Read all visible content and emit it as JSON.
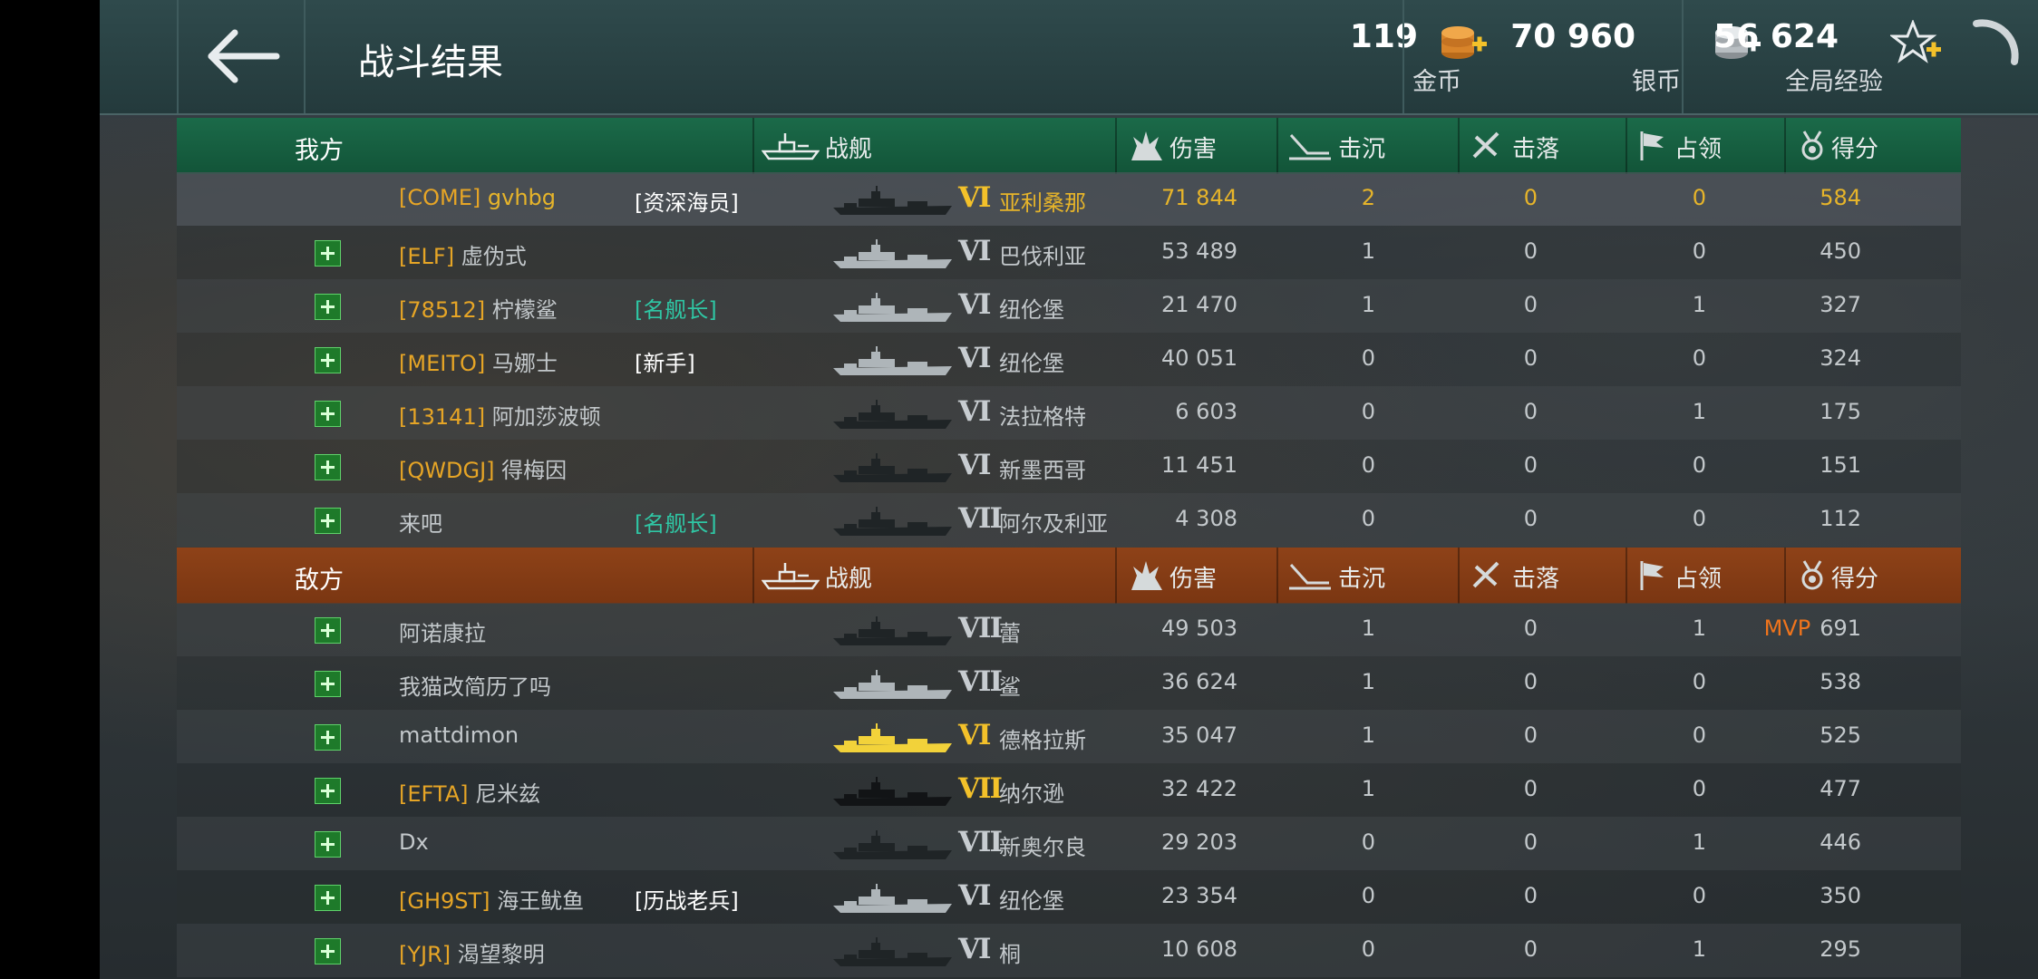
{
  "header": {
    "title": "战斗结果",
    "gold": {
      "value": "119",
      "label": "金币"
    },
    "silver": {
      "value": "70 960",
      "label": "银币"
    },
    "xp": {
      "value": "56 624",
      "label": "全局经验"
    }
  },
  "columns": {
    "ship": "战舰",
    "damage": "伤害",
    "kills": "击沉",
    "planes": "击落",
    "capture": "占领",
    "score": "得分"
  },
  "allies": {
    "label": "我方",
    "players": [
      {
        "clan": "[COME]",
        "name": "gvhbg",
        "title": "[资深海员]",
        "title_type": "vet",
        "tier": "VI",
        "ship": "亚利桑那",
        "damage": "71 844",
        "kills": "2",
        "planes": "0",
        "capture": "0",
        "score": "584",
        "is_me": true,
        "sil": "dark"
      },
      {
        "clan": "[ELF]",
        "name": "虚伪式",
        "title": "",
        "title_type": "",
        "tier": "VI",
        "ship": "巴伐利亚",
        "damage": "53 489",
        "kills": "1",
        "planes": "0",
        "capture": "0",
        "score": "450",
        "sil": "light"
      },
      {
        "clan": "[78512]",
        "name": "柠檬鲨",
        "title": "[名舰长]",
        "title_type": "cap",
        "tier": "VI",
        "ship": "纽伦堡",
        "damage": "21 470",
        "kills": "1",
        "planes": "0",
        "capture": "1",
        "score": "327",
        "sil": "light"
      },
      {
        "clan": "[MEITO]",
        "name": "马娜士",
        "title": "[新手]",
        "title_type": "vet",
        "tier": "VI",
        "ship": "纽伦堡",
        "damage": "40 051",
        "kills": "0",
        "planes": "0",
        "capture": "0",
        "score": "324",
        "sil": "light"
      },
      {
        "clan": "[13141]",
        "name": "阿加莎波顿",
        "title": "",
        "title_type": "",
        "tier": "VI",
        "ship": "法拉格特",
        "damage": "6 603",
        "kills": "0",
        "planes": "0",
        "capture": "1",
        "score": "175",
        "sil": "dark"
      },
      {
        "clan": "[QWDGJ]",
        "name": "得梅因",
        "title": "",
        "title_type": "",
        "tier": "VI",
        "ship": "新墨西哥",
        "damage": "11 451",
        "kills": "0",
        "planes": "0",
        "capture": "0",
        "score": "151",
        "sil": "dark"
      },
      {
        "clan": "",
        "name": "来吧",
        "title": "[名舰长]",
        "title_type": "cap",
        "tier": "VII",
        "ship": "阿尔及利亚",
        "damage": "4 308",
        "kills": "0",
        "planes": "0",
        "capture": "0",
        "score": "112",
        "sil": "dark"
      }
    ]
  },
  "enemies": {
    "label": "敌方",
    "players": [
      {
        "clan": "",
        "name": "阿诺康拉",
        "title": "",
        "title_type": "",
        "tier": "VII",
        "ship": "蕾",
        "damage": "49 503",
        "kills": "1",
        "planes": "0",
        "capture": "1",
        "score": "691",
        "mvp": "MVP",
        "sil": "dark"
      },
      {
        "clan": "",
        "name": "我猫改简历了吗",
        "title": "",
        "title_type": "",
        "tier": "VII",
        "ship": "鲨",
        "damage": "36 624",
        "kills": "1",
        "planes": "0",
        "capture": "0",
        "score": "538",
        "sil": "light"
      },
      {
        "clan": "",
        "name": "mattdimon",
        "title": "",
        "title_type": "",
        "tier": "VI",
        "ship": "德格拉斯",
        "damage": "35 047",
        "kills": "1",
        "planes": "0",
        "capture": "0",
        "score": "525",
        "sil": "gold",
        "tier_gold": true
      },
      {
        "clan": "[EFTA]",
        "name": "尼米兹",
        "title": "",
        "title_type": "",
        "tier": "VII",
        "ship": "纳尔逊",
        "damage": "32 422",
        "kills": "1",
        "planes": "0",
        "capture": "0",
        "score": "477",
        "sil": "black",
        "tier_gold": true
      },
      {
        "clan": "",
        "name": "Dx",
        "title": "",
        "title_type": "",
        "tier": "VII",
        "ship": "新奥尔良",
        "damage": "29 203",
        "kills": "0",
        "planes": "0",
        "capture": "1",
        "score": "446",
        "sil": "dark"
      },
      {
        "clan": "[GH9ST]",
        "name": "海王鱿鱼",
        "title": "[历战老兵]",
        "title_type": "vet",
        "tier": "VI",
        "ship": "纽伦堡",
        "damage": "23 354",
        "kills": "0",
        "planes": "0",
        "capture": "0",
        "score": "350",
        "sil": "light"
      },
      {
        "clan": "[YJR]",
        "name": "渴望黎明",
        "title": "",
        "title_type": "",
        "tier": "VI",
        "ship": "桐",
        "damage": "10 608",
        "kills": "0",
        "planes": "0",
        "capture": "1",
        "score": "295",
        "sil": "dark"
      }
    ]
  },
  "colors": {
    "allies_header": "#1b6a49",
    "enemies_header": "#8e4218",
    "clan_tag": "#e6a526",
    "captain_title": "#2fc6a4",
    "mvp": "#f0741c",
    "me_highlight": "#e6b42a"
  }
}
